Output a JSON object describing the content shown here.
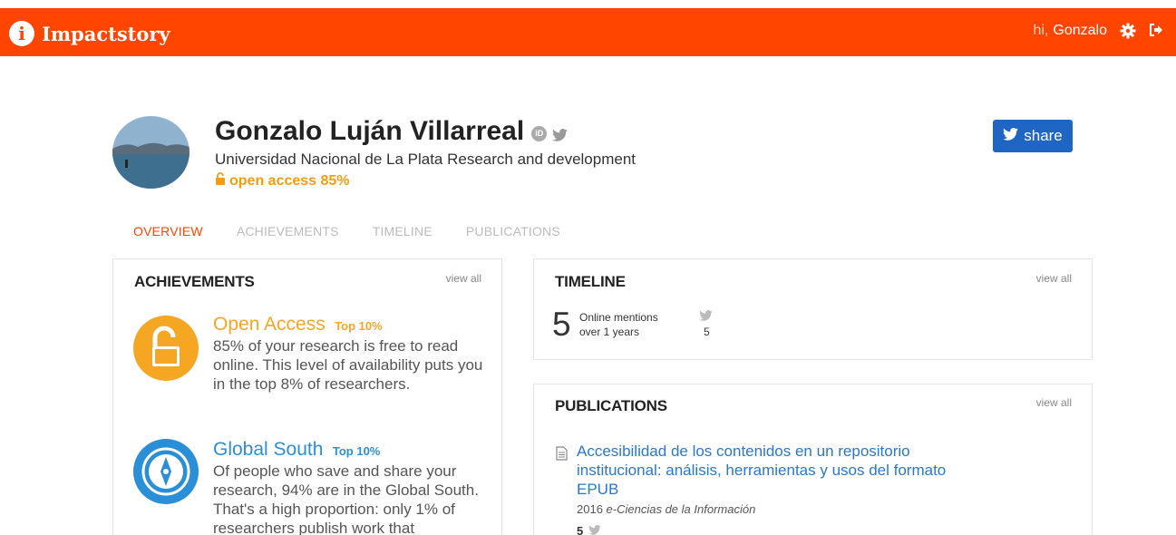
{
  "header": {
    "brand_glyph": "i",
    "brand": "Impactstory",
    "greeting": "hi,",
    "username": "Gonzalo",
    "settings_icon": "gear-icon",
    "logout_icon": "sign-out-icon",
    "color": "#ff4500"
  },
  "profile": {
    "name": "Gonzalo Luján Villarreal",
    "orcid_glyph": "iD",
    "affiliation": "Universidad Nacional de La Plata Research and development",
    "open_access": "open access 85%",
    "share_label": "share"
  },
  "tabs": [
    {
      "label": "OVERVIEW",
      "active": true
    },
    {
      "label": "ACHIEVEMENTS",
      "active": false
    },
    {
      "label": "TIMELINE",
      "active": false
    },
    {
      "label": "PUBLICATIONS",
      "active": false
    }
  ],
  "achievements": {
    "title": "ACHIEVEMENTS",
    "view_all": "view all",
    "items": [
      {
        "title": "Open Access",
        "badge": "Top 10%",
        "description": "85% of your research is free to read online. This level of availability puts you in the top 8% of researchers.",
        "color": "#f5a623",
        "icon": "unlock-icon"
      },
      {
        "title": "Global South",
        "badge": "Top 10%",
        "description": "Of people who save and share your research, 94% are in the Global South. That's a high proportion: only 1% of researchers publish work that",
        "color": "#2b8fd8",
        "icon": "compass-icon"
      }
    ]
  },
  "timeline": {
    "title": "TIMELINE",
    "view_all": "view all",
    "count": "5",
    "label_line1": "Online mentions",
    "label_line2": "over 1 years",
    "twitter_count": "5"
  },
  "publications": {
    "title": "PUBLICATIONS",
    "view_all": "view all",
    "items": [
      {
        "title": "Accesibilidad de los contenidos en un repositorio institucional: análisis, herramientas y usos del formato EPUB",
        "year": "2016",
        "venue": "e-Ciencias de la Información",
        "mentions": "5"
      }
    ]
  }
}
